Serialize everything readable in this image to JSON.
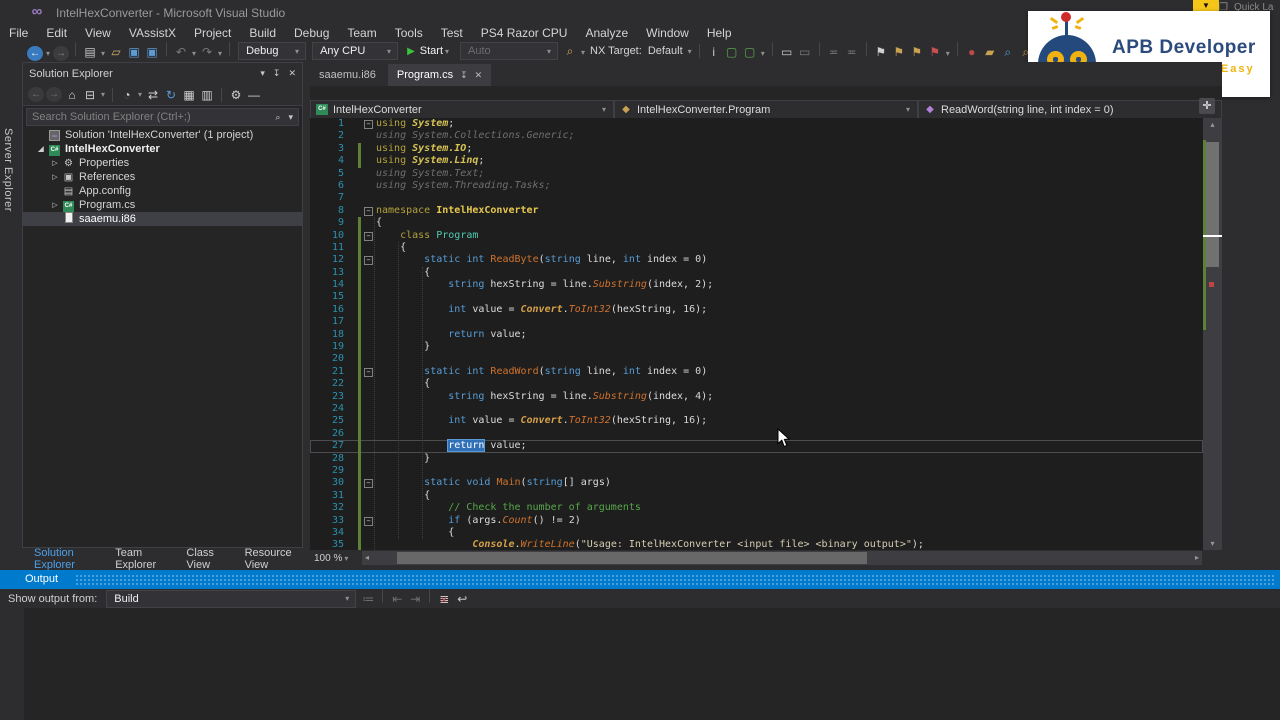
{
  "window": {
    "title": "IntelHexConverter - Microsoft Visual Studio",
    "quick_launch": "Quick La"
  },
  "glyphs": {
    "caret": "▾",
    "play": "▶",
    "up": "▴",
    "down": "▾",
    "left": "◂",
    "right": "▸",
    "close": "✕",
    "pin": "↧",
    "search": "⌕",
    "fold_collapse": "−",
    "move_pan": "✛",
    "badge_triangle": "▼",
    "window_icon": "❐",
    "vs_logo": "∞"
  },
  "menus": [
    "File",
    "Edit",
    "View",
    "VAssistX",
    "Project",
    "Build",
    "Debug",
    "Team",
    "Tools",
    "Test",
    "PS4 Razor CPU",
    "Analyze",
    "Window",
    "Help"
  ],
  "toolbar": {
    "configuration": "Debug",
    "platform": "Any CPU",
    "start": "Start",
    "attach": "Auto",
    "nx_label": "NX Target:",
    "nx_value": "Default",
    "left_icons": [
      {
        "n": "navigate-back-icon",
        "g": "←",
        "c": "#ffffff",
        "bg": "#3a7bbf",
        "circle": 1
      },
      {
        "caret": 1
      },
      {
        "n": "navigate-forward-icon",
        "g": "→",
        "c": "#8a8a8a",
        "bg": "#3c3c3e",
        "circle": 1
      },
      {
        "sep": 1
      },
      {
        "n": "new-project-icon",
        "g": "▤",
        "c": "#c8c8c8"
      },
      {
        "caret": 1
      },
      {
        "n": "open-file-icon",
        "g": "▱",
        "c": "#d8b26a"
      },
      {
        "n": "save-icon",
        "g": "▣",
        "c": "#5b9bd5"
      },
      {
        "n": "save-all-icon",
        "g": "▣",
        "c": "#5b9bd5"
      },
      {
        "sep": 1
      },
      {
        "n": "undo-icon",
        "g": "↶",
        "c": "#7a7a7a"
      },
      {
        "caret": 1
      },
      {
        "n": "redo-icon",
        "g": "↷",
        "c": "#7a7a7a"
      },
      {
        "caret": 1
      },
      {
        "sep": 1
      }
    ],
    "mid_icons": [
      {
        "n": "vassistx-icon",
        "g": "⌕",
        "c": "#d8a84a"
      },
      {
        "caret": 1
      }
    ],
    "right_icons": [
      {
        "n": "attach-info-icon",
        "g": "i",
        "c": "#c8c8c8"
      },
      {
        "n": "box-selection-icon",
        "g": "▢",
        "c": "#57a64a"
      },
      {
        "n": "box-selection-alt-icon",
        "g": "▢",
        "c": "#57a64a"
      },
      {
        "caret": 1
      },
      {
        "sep": 1
      },
      {
        "n": "move-item-icon",
        "g": "▭",
        "c": "#c8c8c8"
      },
      {
        "n": "copy-item-icon",
        "g": "▭",
        "c": "#7a7a7a"
      },
      {
        "sep": 1
      },
      {
        "n": "list-up-icon",
        "g": "≖",
        "c": "#6a6a6a"
      },
      {
        "n": "list-down-icon",
        "g": "≖",
        "c": "#6a6a6a"
      },
      {
        "sep": 1
      },
      {
        "n": "bookmark-icon",
        "g": "⚑",
        "c": "#d0d0d0"
      },
      {
        "n": "next-bookmark-icon",
        "g": "⚑",
        "c": "#c8a252"
      },
      {
        "n": "prev-bookmark-icon",
        "g": "⚑",
        "c": "#c8a252"
      },
      {
        "n": "clear-bookmarks-icon",
        "g": "⚑",
        "c": "#c75050"
      },
      {
        "caret": 1
      },
      {
        "sep": 1
      },
      {
        "n": "tomato-tool-icon",
        "g": "●",
        "c": "#c04848"
      },
      {
        "n": "gold-folder-icon",
        "g": "▰",
        "c": "#c8a252"
      },
      {
        "n": "find-tool-icon",
        "g": "⌕",
        "c": "#5b9bd5"
      },
      {
        "n": "find-gold-icon",
        "g": "⌕",
        "c": "#c8a252"
      },
      {
        "n": "nav-prev-icon",
        "g": "◂",
        "c": "#c8a252"
      },
      {
        "n": "nav-next-icon",
        "g": "▸",
        "c": "#c8a252"
      },
      {
        "n": "history-icon",
        "g": "↶",
        "c": "#c8a252"
      },
      {
        "n": "spell-check-icon",
        "g": "✓",
        "c": "#57a64a"
      }
    ]
  },
  "overlay": {
    "title": "APB Developer",
    "subtitle": "Games Made Easy"
  },
  "server_explorer": {
    "label": "Server Explorer"
  },
  "solution_explorer": {
    "title": "Solution Explorer",
    "search_placeholder": "Search Solution Explorer (Ctrl+;)",
    "toolbar_icons": [
      {
        "n": "back-icon",
        "g": "←",
        "c": "#777777",
        "bg": "#3a3a3c",
        "circle": 1
      },
      {
        "n": "forward-icon",
        "g": "→",
        "c": "#777777",
        "bg": "#3a3a3c",
        "circle": 1
      },
      {
        "n": "home-icon",
        "g": "⌂",
        "c": "#d0d0d0"
      },
      {
        "n": "collapse-all-icon",
        "g": "⊟",
        "c": "#d0d0d0"
      },
      {
        "caret": 1
      },
      {
        "sep": 1
      },
      {
        "n": "pending-changes-filter-icon",
        "g": "◔",
        "c": "#d0d0d0"
      },
      {
        "caret": 1
      },
      {
        "n": "sync-with-active-document-icon",
        "g": "⇄",
        "c": "#d0d0d0"
      },
      {
        "n": "refresh-icon",
        "g": "↻",
        "c": "#5b9bd5"
      },
      {
        "n": "show-all-files-icon",
        "g": "▦",
        "c": "#d0d0d0"
      },
      {
        "n": "copy-icon",
        "g": "▥",
        "c": "#d0d0d0"
      },
      {
        "sep": 1
      },
      {
        "n": "properties-wrench-icon",
        "g": "⚙",
        "c": "#d0d0d0"
      },
      {
        "n": "preview-icon",
        "g": "—",
        "c": "#d0d0d0"
      }
    ],
    "tree": [
      {
        "label": "Solution 'IntelHexConverter' (1 project)",
        "icon": "solution",
        "exp": "none",
        "ind": 1
      },
      {
        "label": "IntelHexConverter",
        "icon": "csproj",
        "exp": "open",
        "ind": 1,
        "bold": true
      },
      {
        "label": "Properties",
        "icon": "wrench",
        "exp": "closed",
        "ind": 2
      },
      {
        "label": "References",
        "icon": "references",
        "exp": "closed",
        "ind": 2
      },
      {
        "label": "App.config",
        "icon": "config",
        "exp": "none",
        "ind": 2
      },
      {
        "label": "Program.cs",
        "icon": "csfile",
        "exp": "closed",
        "ind": 2
      },
      {
        "label": "saaemu.i86",
        "icon": "file",
        "exp": "none",
        "ind": 2,
        "selected": true
      }
    ]
  },
  "panel_tabs": [
    {
      "label": "Solution Explorer",
      "active": true
    },
    {
      "label": "Team Explorer",
      "active": false
    },
    {
      "label": "Class View",
      "active": false
    },
    {
      "label": "Resource View",
      "active": false
    }
  ],
  "editor": {
    "tabs": [
      {
        "label": "saaemu.i86",
        "active": false
      },
      {
        "label": "Program.cs",
        "active": true
      }
    ],
    "navbar": {
      "project": "IntelHexConverter",
      "type": "IntelHexConverter.Program",
      "member": "ReadWord(string line, int index = 0)"
    },
    "zoom": "100 %",
    "lines": [
      {
        "n": 1,
        "f": 1,
        "b": 0,
        "t": [
          [
            "kwy",
            "using"
          ],
          [
            "pl",
            " "
          ],
          [
            "sys",
            "System"
          ],
          [
            "pl",
            ";"
          ]
        ]
      },
      {
        "n": 2,
        "b": 0,
        "t": [
          [
            "gray",
            "using System.Collections.Generic;"
          ]
        ]
      },
      {
        "n": 3,
        "b": 1,
        "t": [
          [
            "kwy",
            "using"
          ],
          [
            "pl",
            " "
          ],
          [
            "sys",
            "System.IO"
          ],
          [
            "pl",
            ";"
          ]
        ]
      },
      {
        "n": 4,
        "b": 1,
        "t": [
          [
            "kwy",
            "using"
          ],
          [
            "pl",
            " "
          ],
          [
            "sys",
            "System.Linq"
          ],
          [
            "pl",
            ";"
          ]
        ]
      },
      {
        "n": 5,
        "b": 0,
        "t": [
          [
            "gray",
            "using System.Text;"
          ]
        ]
      },
      {
        "n": 6,
        "b": 0,
        "t": [
          [
            "gray",
            "using System.Threading.Tasks;"
          ]
        ]
      },
      {
        "n": 7,
        "b": 0,
        "t": []
      },
      {
        "n": 8,
        "f": 1,
        "b": 0,
        "t": [
          [
            "kwy",
            "namespace"
          ],
          [
            "pl",
            " "
          ],
          [
            "ns",
            "IntelHexConverter"
          ]
        ]
      },
      {
        "n": 9,
        "b": 1,
        "t": [
          [
            "pl",
            "{"
          ]
        ]
      },
      {
        "n": 10,
        "f": 1,
        "b": 1,
        "t": [
          [
            "pl",
            "    "
          ],
          [
            "kwy",
            "class"
          ],
          [
            "pl",
            " "
          ],
          [
            "type",
            "Program"
          ]
        ]
      },
      {
        "n": 11,
        "b": 1,
        "t": [
          [
            "pl",
            "    {"
          ]
        ]
      },
      {
        "n": 12,
        "f": 1,
        "b": 1,
        "t": [
          [
            "pl",
            "        "
          ],
          [
            "kw",
            "static"
          ],
          [
            "pl",
            " "
          ],
          [
            "kw",
            "int"
          ],
          [
            "pl",
            " "
          ],
          [
            "meth",
            "ReadByte"
          ],
          [
            "pl",
            "("
          ],
          [
            "kw",
            "string"
          ],
          [
            "pl",
            " line, "
          ],
          [
            "kw",
            "int"
          ],
          [
            "pl",
            " index = "
          ],
          [
            "num",
            "0"
          ],
          [
            "pl",
            ")"
          ]
        ]
      },
      {
        "n": 13,
        "b": 1,
        "t": [
          [
            "pl",
            "        {"
          ]
        ]
      },
      {
        "n": 14,
        "b": 1,
        "t": [
          [
            "pl",
            "            "
          ],
          [
            "kw",
            "string"
          ],
          [
            "pl",
            " hexString = line."
          ],
          [
            "methi",
            "Substring"
          ],
          [
            "pl",
            "(index, "
          ],
          [
            "num",
            "2"
          ],
          [
            "pl",
            ");"
          ]
        ]
      },
      {
        "n": 15,
        "b": 1,
        "t": []
      },
      {
        "n": 16,
        "b": 1,
        "t": [
          [
            "pl",
            "            "
          ],
          [
            "kw",
            "int"
          ],
          [
            "pl",
            " value = "
          ],
          [
            "cls",
            "Convert"
          ],
          [
            "pl",
            "."
          ],
          [
            "methi",
            "ToInt32"
          ],
          [
            "pl",
            "(hexString, "
          ],
          [
            "num",
            "16"
          ],
          [
            "pl",
            ");"
          ]
        ]
      },
      {
        "n": 17,
        "b": 1,
        "t": []
      },
      {
        "n": 18,
        "b": 1,
        "t": [
          [
            "pl",
            "            "
          ],
          [
            "kw",
            "return"
          ],
          [
            "pl",
            " value;"
          ]
        ]
      },
      {
        "n": 19,
        "b": 1,
        "t": [
          [
            "pl",
            "        }"
          ]
        ]
      },
      {
        "n": 20,
        "b": 1,
        "t": []
      },
      {
        "n": 21,
        "f": 1,
        "b": 1,
        "t": [
          [
            "pl",
            "        "
          ],
          [
            "kw",
            "static"
          ],
          [
            "pl",
            " "
          ],
          [
            "kw",
            "int"
          ],
          [
            "pl",
            " "
          ],
          [
            "meth",
            "ReadWord"
          ],
          [
            "pl",
            "("
          ],
          [
            "kw",
            "string"
          ],
          [
            "pl",
            " line, "
          ],
          [
            "kw",
            "int"
          ],
          [
            "pl",
            " index = "
          ],
          [
            "num",
            "0"
          ],
          [
            "pl",
            ")"
          ]
        ]
      },
      {
        "n": 22,
        "b": 1,
        "t": [
          [
            "pl",
            "        {"
          ]
        ]
      },
      {
        "n": 23,
        "b": 1,
        "t": [
          [
            "pl",
            "            "
          ],
          [
            "kw",
            "string"
          ],
          [
            "pl",
            " hexString = line."
          ],
          [
            "methi",
            "Substring"
          ],
          [
            "pl",
            "(index, "
          ],
          [
            "num",
            "4"
          ],
          [
            "pl",
            ");"
          ]
        ]
      },
      {
        "n": 24,
        "b": 1,
        "t": []
      },
      {
        "n": 25,
        "b": 1,
        "t": [
          [
            "pl",
            "            "
          ],
          [
            "kw",
            "int"
          ],
          [
            "pl",
            " value = "
          ],
          [
            "cls",
            "Convert"
          ],
          [
            "pl",
            "."
          ],
          [
            "methi",
            "ToInt32"
          ],
          [
            "pl",
            "(hexString, "
          ],
          [
            "num",
            "16"
          ],
          [
            "pl",
            ");"
          ]
        ]
      },
      {
        "n": 26,
        "b": 1,
        "t": []
      },
      {
        "n": 27,
        "b": 1,
        "c": 1,
        "t": [
          [
            "pl",
            "            "
          ],
          [
            "sel",
            "return"
          ],
          [
            "pl",
            " value;"
          ]
        ]
      },
      {
        "n": 28,
        "b": 1,
        "t": [
          [
            "pl",
            "        }"
          ]
        ]
      },
      {
        "n": 29,
        "b": 1,
        "t": []
      },
      {
        "n": 30,
        "f": 1,
        "b": 1,
        "t": [
          [
            "pl",
            "        "
          ],
          [
            "kw",
            "static"
          ],
          [
            "pl",
            " "
          ],
          [
            "kw",
            "void"
          ],
          [
            "pl",
            " "
          ],
          [
            "meth",
            "Main"
          ],
          [
            "pl",
            "("
          ],
          [
            "kw",
            "string"
          ],
          [
            "pl",
            "[] args)"
          ]
        ]
      },
      {
        "n": 31,
        "b": 1,
        "t": [
          [
            "pl",
            "        {"
          ]
        ]
      },
      {
        "n": 32,
        "b": 1,
        "t": [
          [
            "pl",
            "            "
          ],
          [
            "com",
            "// Check the number of arguments"
          ]
        ]
      },
      {
        "n": 33,
        "f": 1,
        "b": 1,
        "t": [
          [
            "pl",
            "            "
          ],
          [
            "kw",
            "if"
          ],
          [
            "pl",
            " (args."
          ],
          [
            "methi",
            "Count"
          ],
          [
            "pl",
            "() != "
          ],
          [
            "num",
            "2"
          ],
          [
            "pl",
            ")"
          ]
        ]
      },
      {
        "n": 34,
        "b": 1,
        "t": [
          [
            "pl",
            "            {"
          ]
        ]
      },
      {
        "n": 35,
        "b": 1,
        "t": [
          [
            "pl",
            "                "
          ],
          [
            "cls",
            "Console"
          ],
          [
            "pl",
            "."
          ],
          [
            "methi",
            "WriteLine"
          ],
          [
            "pl",
            "("
          ],
          [
            "str",
            "\"Usage: IntelHexConverter <input file> <binary output>\""
          ],
          [
            "pl",
            ");"
          ]
        ]
      }
    ]
  },
  "output": {
    "title": "Output",
    "show_from": "Show output from:",
    "source": "Build",
    "icons": [
      {
        "n": "messages-icon",
        "g": "≔",
        "c": "#6e6e6e"
      },
      {
        "sep": 1
      },
      {
        "n": "goto-previous-message-icon",
        "g": "⇤",
        "c": "#6e6e6e"
      },
      {
        "n": "goto-next-message-icon",
        "g": "⇥",
        "c": "#6e6e6e"
      },
      {
        "sep": 1
      },
      {
        "n": "clear-all-icon",
        "g": "≣",
        "c": "#c8c8c8",
        "g2": "✕",
        "c2": "#c75050"
      },
      {
        "n": "toggle-word-wrap-icon",
        "g": "↩",
        "c": "#c8c8c8"
      }
    ]
  },
  "colors": {
    "accent_blue": "#007acc",
    "selection_blue": "#3070b8",
    "change_bar_green": "#5c8137",
    "logo_navy": "#2b4a7d",
    "logo_gold": "#efb30f",
    "editor_bg": "#1e1e1e"
  }
}
